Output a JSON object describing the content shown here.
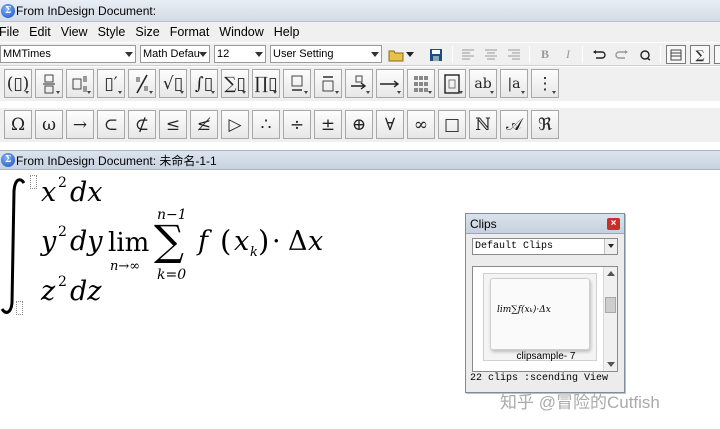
{
  "window": {
    "title": "From InDesign Document:"
  },
  "menu": [
    "File",
    "Edit",
    "View",
    "Style",
    "Size",
    "Format",
    "Window",
    "Help"
  ],
  "format_bar": {
    "font": "MMTimes",
    "style": "Math Defau",
    "size": "12",
    "setting": "User Setting",
    "bold_label": "B",
    "italic_label": "I"
  },
  "palette_row1_icons": [
    "fence-parentheses-icon",
    "fraction-icon",
    "subscript-template-icon",
    "prime-icon",
    "slash-icon",
    "radical-icon",
    "integral-template-icon",
    "summation-icon",
    "product-icon",
    "underbar-icon",
    "overbar-icon",
    "arrow-label-icon",
    "long-arrow-icon",
    "matrix-icon",
    "box-template-icon",
    "ab-label-icon",
    "bracket-a-icon",
    "vertical-dots-icon"
  ],
  "palette_row2": [
    "Ω",
    "ω",
    "→",
    "⊂",
    "⊄",
    "≤",
    "≰",
    "▷",
    "∴",
    "÷",
    "±",
    "⊕",
    "∀",
    "∞",
    "□",
    "ℕ",
    "𝒜",
    "ℜ"
  ],
  "document": {
    "title": "From InDesign Document: 未命名-1-1"
  },
  "equation": {
    "line1": "x",
    "line1_exp": "2",
    "line1_tail": "dx",
    "line2_y": "y",
    "line2_exp": "2",
    "line2_dy": "dy",
    "lim": "lim",
    "lim_sub": "n→∞",
    "sum_upper": "n−1",
    "sum_lower": "k=0",
    "func": "f",
    "paren_open": "(",
    "arg": "x",
    "arg_sub": "k",
    "paren_close": ")",
    "cdot": "·",
    "delta": "Δ",
    "delta_x": "x",
    "line3": "z",
    "line3_exp": "2",
    "line3_tail": "dz",
    "integral": "∫",
    "sigma": "∑"
  },
  "clips": {
    "title": "Clips",
    "close": "×",
    "selected": "Default Clips",
    "item_name": "clipsample- 7",
    "item_preview": "lim∑f(xₖ)·Δx",
    "status": "22 clips :scending View"
  },
  "watermark": "知乎 @冒险的Cutfish"
}
